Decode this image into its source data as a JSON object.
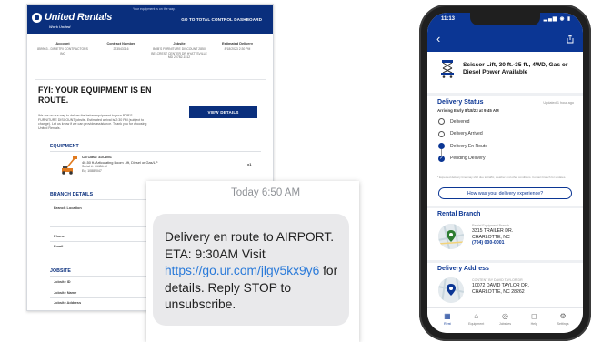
{
  "email": {
    "top_note": "Your equipment is on the way.",
    "brand": "United Rentals",
    "brand_tagline": "Work United",
    "dashboard_link": "GO TO TOTAL CONTROL DASHBOARD",
    "info_columns": [
      {
        "label": "Account",
        "value": "859963 - DIPIETRI CONTRACTORS INC"
      },
      {
        "label": "Contract Number",
        "value": "223543316"
      },
      {
        "label": "Jobsite",
        "value": "BOB'S FURNITURE DISCOUNT 2850 BELCREST CENTER DR HYATTSVILLE MD 20782-1512"
      },
      {
        "label": "Estimated Delivery",
        "value": "8/18/2023 2:30 PM"
      }
    ],
    "headline": "FYI: YOUR EQUIPMENT IS EN ROUTE.",
    "body": "We are on our way to deliver the below equipment to your BOB'S FURNITURE DISCOUNT jobsite. Estimated arrival is 2:30 PM (subject to change). Let us know if we can provide assistance. Thank you for choosing United Rentals.",
    "view_details": "VIEW DETAILS",
    "equipment_heading": "EQUIPMENT",
    "equipment_cat_class": "Cat Class: 310-4001",
    "equipment_name": "40-50 ft. Articulating Boom Lift, Diesel or Gas/LP",
    "equipment_serial": "Serial #: 94484-M",
    "equipment_eq": "Eq: 10882047",
    "equipment_qty": "x1",
    "branch_heading": "BRANCH DETAILS",
    "branch_location_label": "Branch Location",
    "phone_label": "Phone",
    "email_label": "Email",
    "jobsite_heading": "JOBSITE",
    "jobsite_id_label": "Jobsite ID",
    "jobsite_name_label": "Jobsite Name",
    "jobsite_address_label": "Jobsite Address"
  },
  "sms": {
    "time": "Today 6:50 AM",
    "text_before_link": "Delivery en route to AIRPORT. ETA: 9:30AM Visit",
    "link": "https://go.ur.com/jlgv5kx9y6",
    "text_after_link": "for details. Reply STOP to unsubscribe."
  },
  "phone": {
    "status_time": "11:13",
    "status_icons": "▂▄▆ ◉ ▮",
    "equipment_title": "Scissor Lift, 30 ft.-35 ft., 4WD, Gas or Diesel Power Available",
    "delivery_status_heading": "Delivery Status",
    "updated_label": "Updated 1 hour ago",
    "arriving": "Arriving Early 8/18/23 at 9:45 AM",
    "steps": [
      {
        "label": "Delivered",
        "state": "empty"
      },
      {
        "label": "Delivery Arrived",
        "state": "empty"
      },
      {
        "label": "Delivery En Route",
        "state": "fill"
      },
      {
        "label": "Pending Delivery",
        "state": "check"
      }
    ],
    "note": "* Expected delivery time may shift due to traffic, weather and other conditions. Contact branch for updates.",
    "experience_button": "How was your delivery experience?",
    "rental_branch_heading": "Rental Branch",
    "branch_label": "Rental Equipment Branch",
    "branch_address_1": "3315 TRAILER DR.",
    "branch_address_2": "CHARLOTTE, NC",
    "branch_phone": "(704) 000-0001",
    "delivery_address_heading": "Delivery Address",
    "delivery_label": "CONTENT BY DAVID TAYLOR DR",
    "delivery_address_1": "10072 DAVID TAYLOR DR.",
    "delivery_address_2": "CHARLOTTE, NC 28262",
    "tabs": [
      {
        "label": "Rent",
        "icon": "rent-icon"
      },
      {
        "label": "Equipment",
        "icon": "equipment-icon"
      },
      {
        "label": "Jobsites",
        "icon": "jobsites-icon"
      },
      {
        "label": "Help",
        "icon": "help-icon"
      },
      {
        "label": "Settings",
        "icon": "settings-icon"
      }
    ]
  },
  "colors": {
    "brand_blue": "#0a2f7d",
    "app_blue": "#0b3694",
    "link_blue": "#2a7ad9",
    "bubble_gray": "#e9e9eb"
  }
}
